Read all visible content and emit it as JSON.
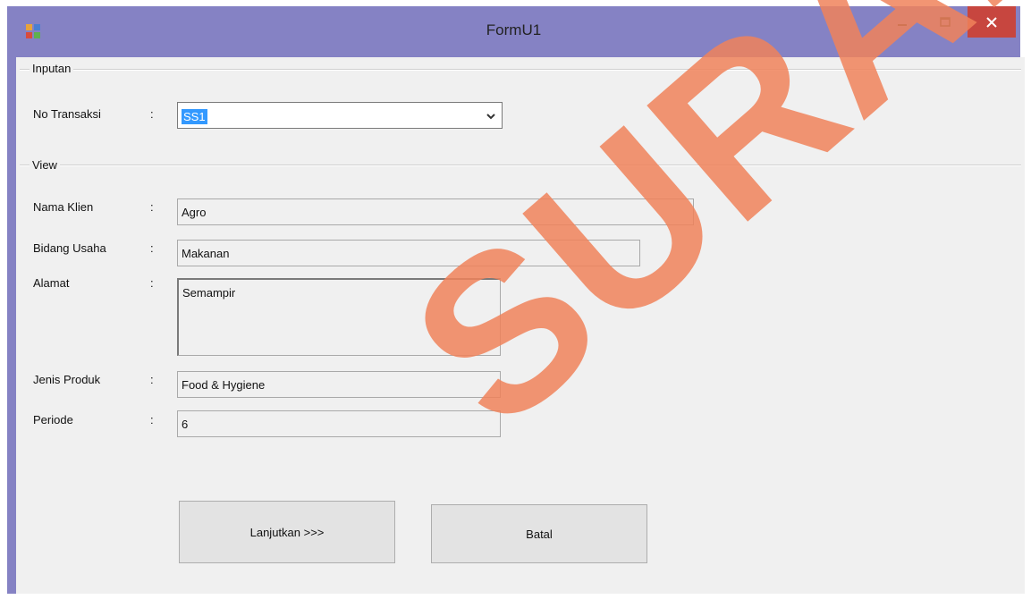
{
  "window": {
    "title": "FormU1",
    "accent_color": "#8582c4",
    "close_color": "#c7463f"
  },
  "inputan": {
    "group_label": "Inputan",
    "no_transaksi_label": "No Transaksi",
    "colon": ":",
    "no_transaksi_value": "SS1"
  },
  "view": {
    "group_label": "View",
    "nama_klien_label": "Nama Klien",
    "nama_klien_value": "Agro",
    "bidang_usaha_label": "Bidang Usaha",
    "bidang_usaha_value": "Makanan",
    "alamat_label": "Alamat",
    "alamat_value": "Semampir",
    "jenis_produk_label": "Jenis Produk",
    "jenis_produk_value": "Food & Hygiene",
    "periode_label": "Periode",
    "periode_value": "6"
  },
  "buttons": {
    "lanjutkan": "Lanjutkan >>>",
    "batal": "Batal"
  },
  "watermark": {
    "text": "SURABAYA"
  }
}
